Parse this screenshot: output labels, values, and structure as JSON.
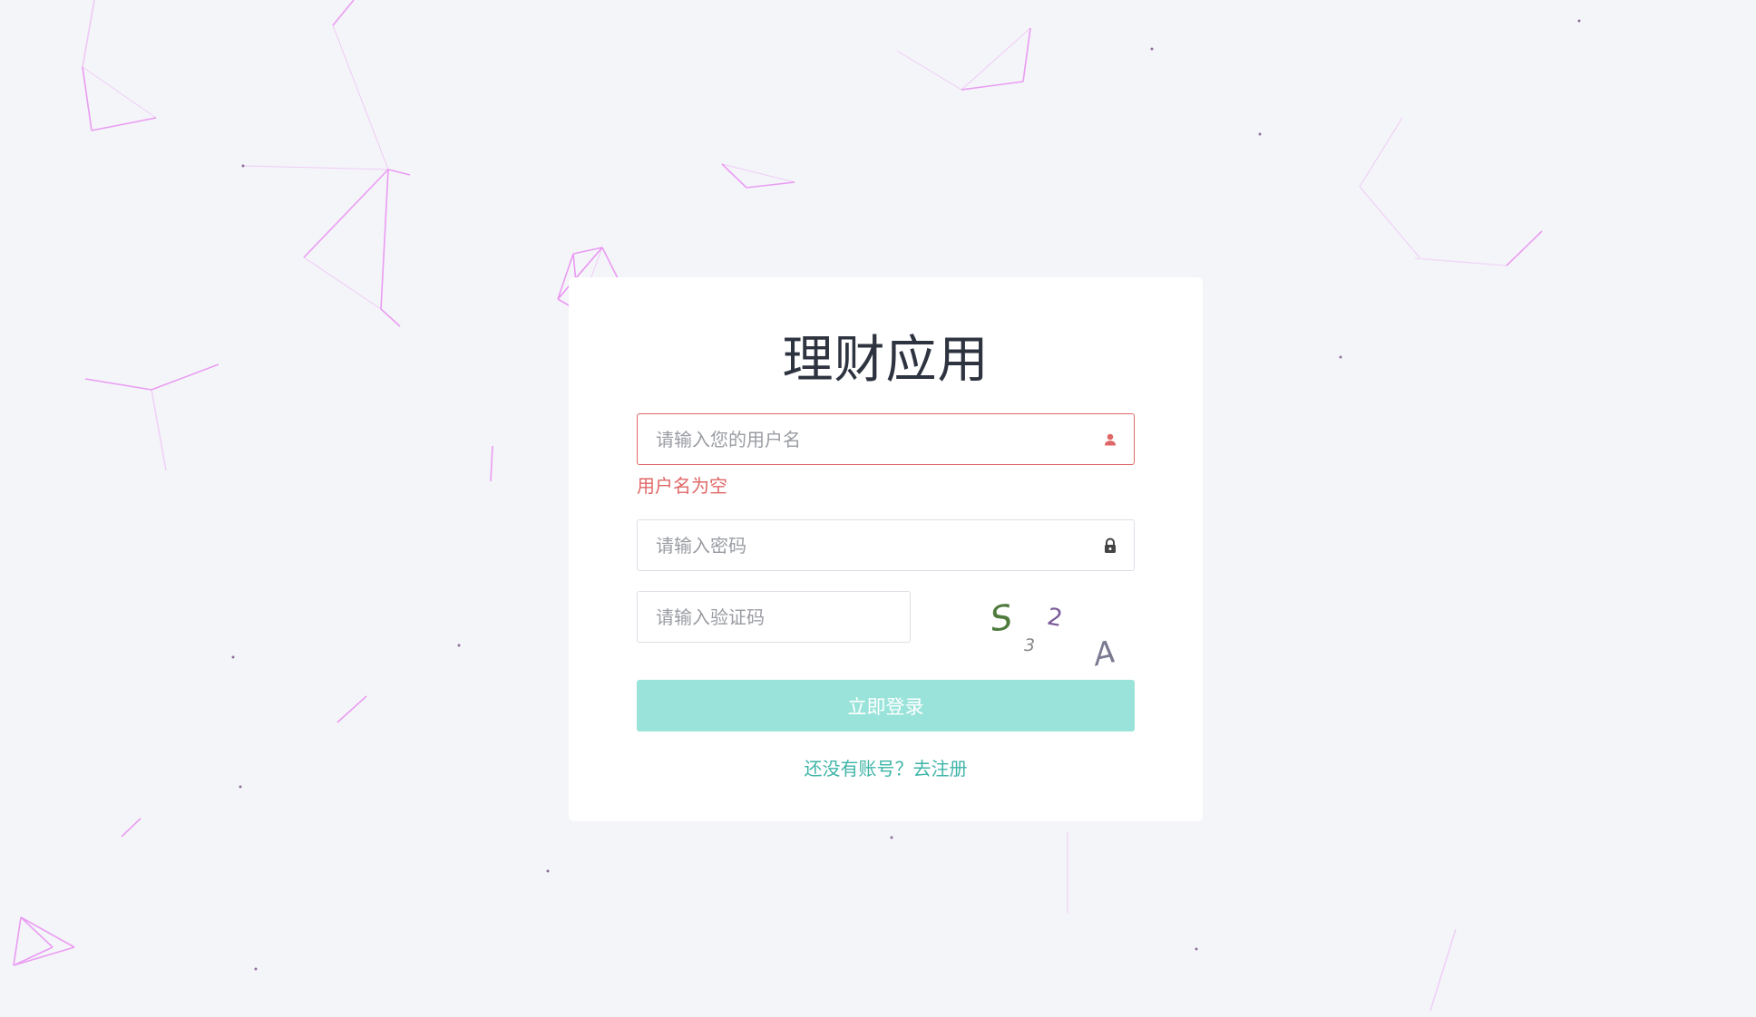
{
  "login": {
    "title": "理财应用",
    "username": {
      "placeholder": "请输入您的用户名",
      "value": "",
      "error": "用户名为空",
      "icon": "user-icon"
    },
    "password": {
      "placeholder": "请输入密码",
      "value": "",
      "icon": "lock-icon"
    },
    "captcha": {
      "placeholder": "请输入验证码",
      "value": "",
      "chars": [
        "S",
        "3",
        "2",
        "A"
      ]
    },
    "submit_label": "立即登录",
    "register_link": "还没有账号？去注册"
  },
  "colors": {
    "background": "#f4f5f9",
    "error": "#e06767",
    "button": "#9ae3da",
    "link": "#3fb5a8",
    "particles": "#e77ef0"
  }
}
